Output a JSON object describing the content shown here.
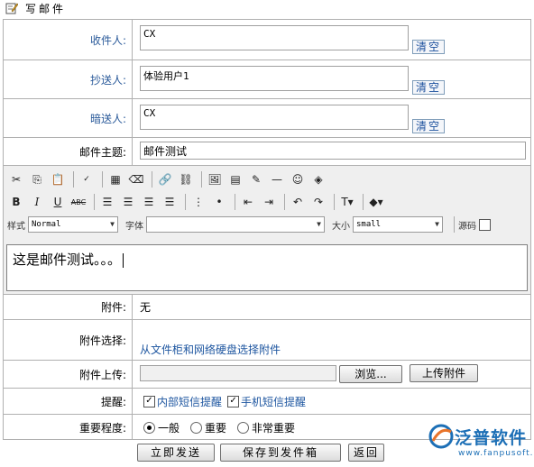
{
  "page_title": "写邮件",
  "recipients": {
    "to": {
      "label": "收件人:",
      "value": "CX",
      "clear": "清空"
    },
    "cc": {
      "label": "抄送人:",
      "value": "体验用户1",
      "clear": "清空"
    },
    "bcc": {
      "label": "暗送人:",
      "value": "CX",
      "clear": "清空"
    }
  },
  "subject": {
    "label": "邮件主题:",
    "value": "邮件测试"
  },
  "editor": {
    "style_label": "样式",
    "style_value": "Normal",
    "font_label": "字体",
    "font_value": "",
    "size_label": "大小",
    "size_value": "small",
    "source_label": "源码",
    "content": "这是邮件测试。。。"
  },
  "attachment": {
    "label": "附件:",
    "value": "无"
  },
  "attach_select": {
    "label": "附件选择:",
    "link": "从文件柜和网络硬盘选择附件"
  },
  "attach_upload": {
    "label": "附件上传:",
    "browse": "浏览...",
    "upload": "上传附件"
  },
  "reminder": {
    "label": "提醒:",
    "options": [
      "内部短信提醒",
      "手机短信提醒"
    ]
  },
  "importance": {
    "label": "重要程度:",
    "options": [
      "一般",
      "重要",
      "非常重要"
    ],
    "selected": "一般"
  },
  "actions": {
    "send": "立即发送",
    "save": "保存到发件箱",
    "back": "返回"
  },
  "logo": {
    "name": "泛普软件",
    "url": "www.fanpusoft.com"
  }
}
